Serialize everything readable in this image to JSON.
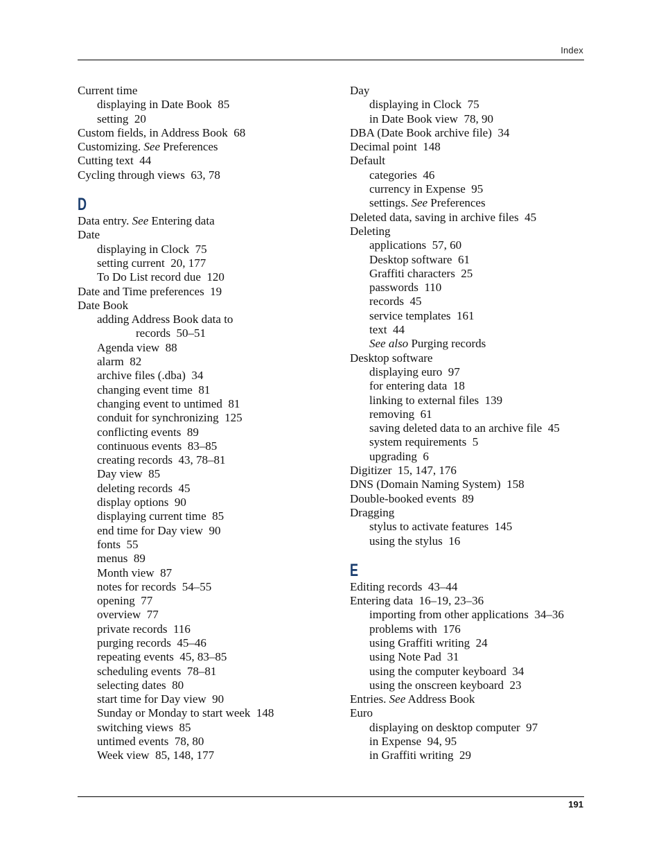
{
  "header": {
    "section_label": "Index"
  },
  "footer": {
    "page_number": "191"
  },
  "columns": {
    "left": [
      {
        "type": "entry",
        "level": 0,
        "text": "Current time"
      },
      {
        "type": "entry",
        "level": 1,
        "text": "displaying in Date Book  85"
      },
      {
        "type": "entry",
        "level": 1,
        "text": "setting  20"
      },
      {
        "type": "entry",
        "level": 0,
        "text": "Custom fields, in Address Book  68"
      },
      {
        "type": "entry",
        "level": 0,
        "text": "Customizing. ",
        "see": "See",
        "after": " Preferences"
      },
      {
        "type": "entry",
        "level": 0,
        "text": "Cutting text  44"
      },
      {
        "type": "entry",
        "level": 0,
        "text": "Cycling through views  63, 78"
      },
      {
        "type": "letter",
        "text": "D"
      },
      {
        "type": "entry",
        "level": 0,
        "text": "Data entry. ",
        "see": "See",
        "after": " Entering data"
      },
      {
        "type": "entry",
        "level": 0,
        "text": "Date"
      },
      {
        "type": "entry",
        "level": 1,
        "text": "displaying in Clock  75"
      },
      {
        "type": "entry",
        "level": 1,
        "text": "setting current  20, 177"
      },
      {
        "type": "entry",
        "level": 1,
        "text": "To Do List record due  120"
      },
      {
        "type": "entry",
        "level": 0,
        "text": "Date and Time preferences  19"
      },
      {
        "type": "entry",
        "level": 0,
        "text": "Date Book"
      },
      {
        "type": "entry",
        "level": 1,
        "text": "adding Address Book data to"
      },
      {
        "type": "entry",
        "level": 2,
        "text": "records  50–51"
      },
      {
        "type": "entry",
        "level": 1,
        "text": "Agenda view  88"
      },
      {
        "type": "entry",
        "level": 1,
        "text": "alarm  82"
      },
      {
        "type": "entry",
        "level": 1,
        "text": "archive files (.dba)  34"
      },
      {
        "type": "entry",
        "level": 1,
        "text": "changing event time  81"
      },
      {
        "type": "entry",
        "level": 1,
        "text": "changing event to untimed  81"
      },
      {
        "type": "entry",
        "level": 1,
        "text": "conduit for synchronizing  125"
      },
      {
        "type": "entry",
        "level": 1,
        "text": "conflicting events  89"
      },
      {
        "type": "entry",
        "level": 1,
        "text": "continuous events  83–85"
      },
      {
        "type": "entry",
        "level": 1,
        "text": "creating records  43, 78–81"
      },
      {
        "type": "entry",
        "level": 1,
        "text": "Day view  85"
      },
      {
        "type": "entry",
        "level": 1,
        "text": "deleting records  45"
      },
      {
        "type": "entry",
        "level": 1,
        "text": "display options  90"
      },
      {
        "type": "entry",
        "level": 1,
        "text": "displaying current time  85"
      },
      {
        "type": "entry",
        "level": 1,
        "text": "end time for Day view  90"
      },
      {
        "type": "entry",
        "level": 1,
        "text": "fonts  55"
      },
      {
        "type": "entry",
        "level": 1,
        "text": "menus  89"
      },
      {
        "type": "entry",
        "level": 1,
        "text": "Month view  87"
      },
      {
        "type": "entry",
        "level": 1,
        "text": "notes for records  54–55"
      },
      {
        "type": "entry",
        "level": 1,
        "text": "opening  77"
      },
      {
        "type": "entry",
        "level": 1,
        "text": "overview  77"
      },
      {
        "type": "entry",
        "level": 1,
        "text": "private records  116"
      },
      {
        "type": "entry",
        "level": 1,
        "text": "purging records  45–46"
      },
      {
        "type": "entry",
        "level": 1,
        "text": "repeating events  45, 83–85"
      },
      {
        "type": "entry",
        "level": 1,
        "text": "scheduling events  78–81"
      },
      {
        "type": "entry",
        "level": 1,
        "text": "selecting dates  80"
      },
      {
        "type": "entry",
        "level": 1,
        "text": "start time for Day view  90"
      },
      {
        "type": "entry",
        "level": 1,
        "text": "Sunday or Monday to start week  148"
      },
      {
        "type": "entry",
        "level": 1,
        "text": "switching views  85"
      },
      {
        "type": "entry",
        "level": 1,
        "text": "untimed events  78, 80"
      },
      {
        "type": "entry",
        "level": 1,
        "text": "Week view  85, 148, 177"
      }
    ],
    "right": [
      {
        "type": "entry",
        "level": 0,
        "text": "Day"
      },
      {
        "type": "entry",
        "level": 1,
        "text": "displaying in Clock  75"
      },
      {
        "type": "entry",
        "level": 1,
        "text": "in Date Book view  78, 90"
      },
      {
        "type": "entry",
        "level": 0,
        "text": "DBA (Date Book archive file)  34"
      },
      {
        "type": "entry",
        "level": 0,
        "text": "Decimal point  148"
      },
      {
        "type": "entry",
        "level": 0,
        "text": "Default"
      },
      {
        "type": "entry",
        "level": 1,
        "text": "categories  46"
      },
      {
        "type": "entry",
        "level": 1,
        "text": "currency in Expense  95"
      },
      {
        "type": "entry",
        "level": 1,
        "text": "settings. ",
        "see": "See",
        "after": " Preferences"
      },
      {
        "type": "entry",
        "level": 0,
        "text": "Deleted data, saving in archive files  45"
      },
      {
        "type": "entry",
        "level": 0,
        "text": "Deleting"
      },
      {
        "type": "entry",
        "level": 1,
        "text": "applications  57, 60"
      },
      {
        "type": "entry",
        "level": 1,
        "text": "Desktop software  61"
      },
      {
        "type": "entry",
        "level": 1,
        "text": "Graffiti characters  25"
      },
      {
        "type": "entry",
        "level": 1,
        "text": "passwords  110"
      },
      {
        "type": "entry",
        "level": 1,
        "text": "records  45"
      },
      {
        "type": "entry",
        "level": 1,
        "text": "service templates  161"
      },
      {
        "type": "entry",
        "level": 1,
        "text": "text  44"
      },
      {
        "type": "entry",
        "level": 1,
        "text": "",
        "see": "See also",
        "after": " Purging records"
      },
      {
        "type": "entry",
        "level": 0,
        "text": "Desktop software"
      },
      {
        "type": "entry",
        "level": 1,
        "text": "displaying euro  97"
      },
      {
        "type": "entry",
        "level": 1,
        "text": "for entering data  18"
      },
      {
        "type": "entry",
        "level": 1,
        "text": "linking to external files  139"
      },
      {
        "type": "entry",
        "level": 1,
        "text": "removing  61"
      },
      {
        "type": "entry",
        "level": 1,
        "text": "saving deleted data to an archive file  45"
      },
      {
        "type": "entry",
        "level": 1,
        "text": "system requirements  5"
      },
      {
        "type": "entry",
        "level": 1,
        "text": "upgrading  6"
      },
      {
        "type": "entry",
        "level": 0,
        "text": "Digitizer  15, 147, 176"
      },
      {
        "type": "entry",
        "level": 0,
        "text": "DNS (Domain Naming System)  158"
      },
      {
        "type": "entry",
        "level": 0,
        "text": "Double-booked events  89"
      },
      {
        "type": "entry",
        "level": 0,
        "text": "Dragging"
      },
      {
        "type": "entry",
        "level": 1,
        "text": "stylus to activate features  145"
      },
      {
        "type": "entry",
        "level": 1,
        "text": "using the stylus  16"
      },
      {
        "type": "letter",
        "text": "E"
      },
      {
        "type": "entry",
        "level": 0,
        "text": "Editing records  43–44"
      },
      {
        "type": "entry",
        "level": 0,
        "text": "Entering data  16–19, 23–36"
      },
      {
        "type": "entry",
        "level": 1,
        "text": "importing from other applications  34–36"
      },
      {
        "type": "entry",
        "level": 1,
        "text": "problems with  176"
      },
      {
        "type": "entry",
        "level": 1,
        "text": "using Graffiti writing  24"
      },
      {
        "type": "entry",
        "level": 1,
        "text": "using Note Pad  31"
      },
      {
        "type": "entry",
        "level": 1,
        "text": "using the computer keyboard  34"
      },
      {
        "type": "entry",
        "level": 1,
        "text": "using the onscreen keyboard  23"
      },
      {
        "type": "entry",
        "level": 0,
        "text": "Entries. ",
        "see": "See",
        "after": " Address Book"
      },
      {
        "type": "entry",
        "level": 0,
        "text": "Euro"
      },
      {
        "type": "entry",
        "level": 1,
        "text": "displaying on desktop computer  97"
      },
      {
        "type": "entry",
        "level": 1,
        "text": "in Expense  94, 95"
      },
      {
        "type": "entry",
        "level": 1,
        "text": "in Graffiti writing  29"
      }
    ]
  },
  "colors": {
    "section_letter": "#1a3d6e",
    "text": "#111111",
    "rule": "#000000"
  }
}
